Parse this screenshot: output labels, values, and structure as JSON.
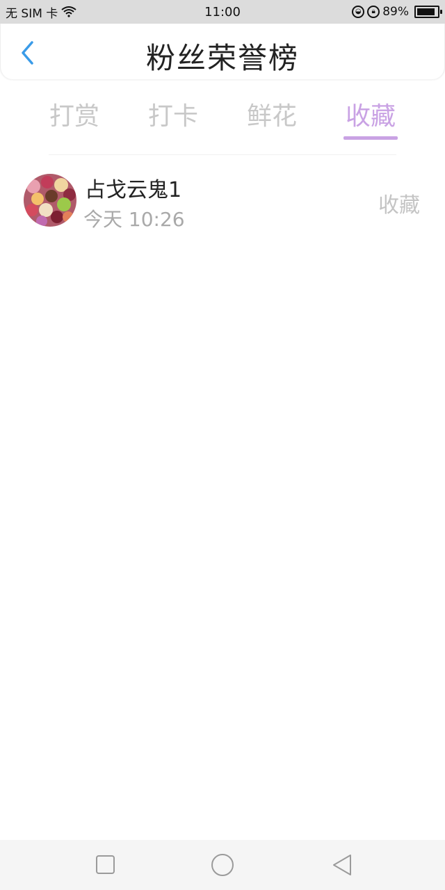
{
  "status_bar": {
    "carrier": "无 SIM 卡",
    "time": "11:00",
    "battery_text": "89%",
    "battery_level": 0.89
  },
  "header": {
    "title": "粉丝荣誉榜"
  },
  "tabs": [
    {
      "label": "打赏"
    },
    {
      "label": "打卡"
    },
    {
      "label": "鲜花"
    },
    {
      "label": "收藏"
    }
  ],
  "active_tab": 3,
  "list": [
    {
      "name": "占戈云鬼1",
      "time": "今天 10:26",
      "action": "收藏"
    }
  ],
  "colors": {
    "accent": "#c9a2e4",
    "back_arrow": "#3a9be8",
    "inactive_tab": "#c8c8c8"
  },
  "icons": {
    "back": "chevron-left-icon",
    "nav_recent": "square-icon",
    "nav_home": "circle-icon",
    "nav_back": "triangle-left-icon"
  }
}
